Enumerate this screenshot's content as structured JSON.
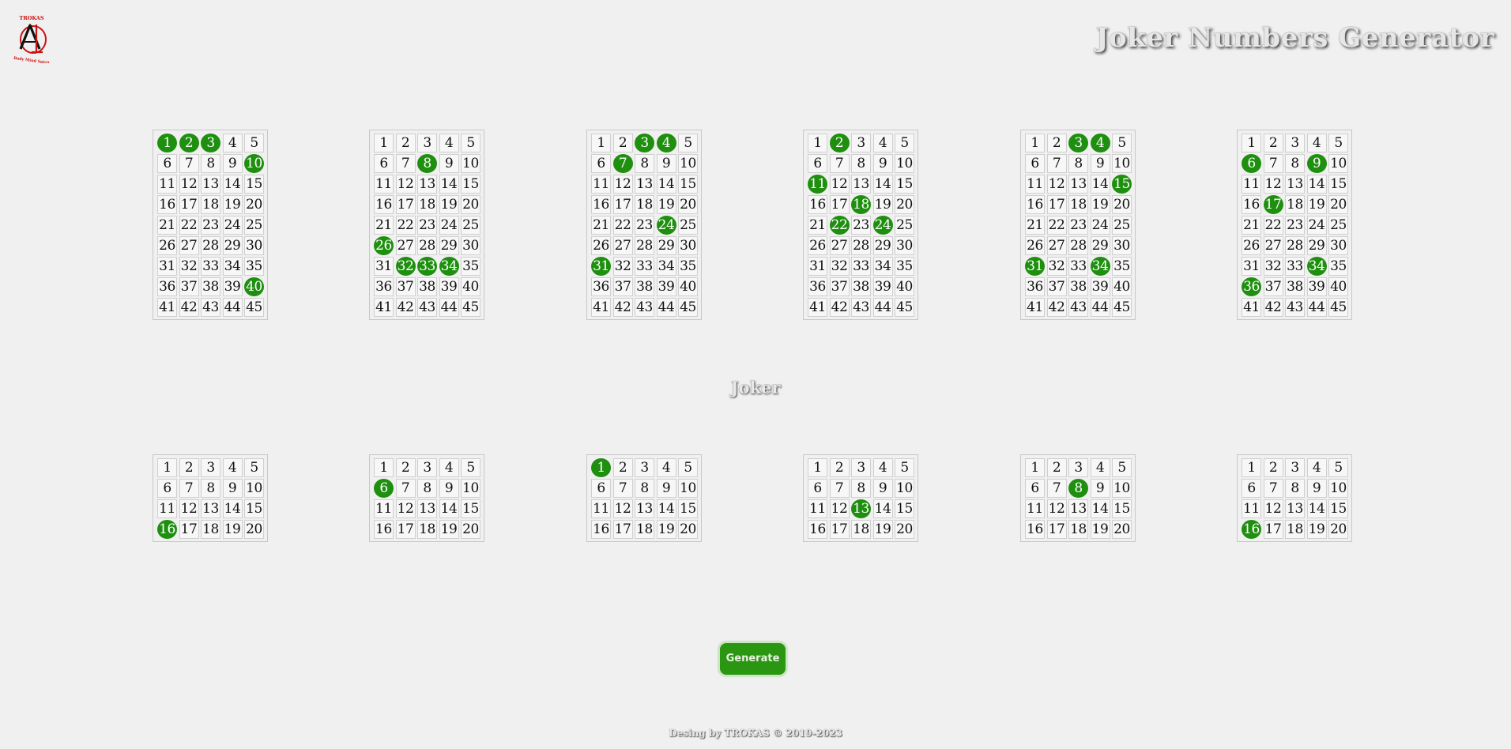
{
  "header": {
    "logo_text": "TROKAS",
    "logo_monogram": "AD",
    "logo_motto": "Body Mind Spirit",
    "title": "Joker Numbers Generator"
  },
  "main_section": {
    "numbers_per_ticket": 45,
    "tickets": [
      {
        "selected": [
          1,
          2,
          3,
          10,
          40
        ]
      },
      {
        "selected": [
          8,
          26,
          32,
          33,
          34
        ]
      },
      {
        "selected": [
          3,
          4,
          7,
          24,
          31
        ]
      },
      {
        "selected": [
          2,
          11,
          18,
          22,
          24
        ]
      },
      {
        "selected": [
          3,
          4,
          15,
          31,
          34
        ]
      },
      {
        "selected": [
          6,
          9,
          17,
          34,
          36
        ]
      }
    ]
  },
  "joker_section": {
    "title": "Joker",
    "numbers_per_ticket": 20,
    "tickets": [
      {
        "selected": [
          16
        ]
      },
      {
        "selected": [
          6
        ]
      },
      {
        "selected": [
          1
        ]
      },
      {
        "selected": [
          13
        ]
      },
      {
        "selected": [
          8
        ]
      },
      {
        "selected": [
          16
        ]
      }
    ]
  },
  "actions": {
    "generate_label": "Generate"
  },
  "footer": {
    "text": "Desing by TROKAS © 2019-2023"
  },
  "colors": {
    "selected": "#1f8f0f",
    "button": "#2a9612",
    "background": "#f0f0f0",
    "logo_red": "#cc1111"
  }
}
